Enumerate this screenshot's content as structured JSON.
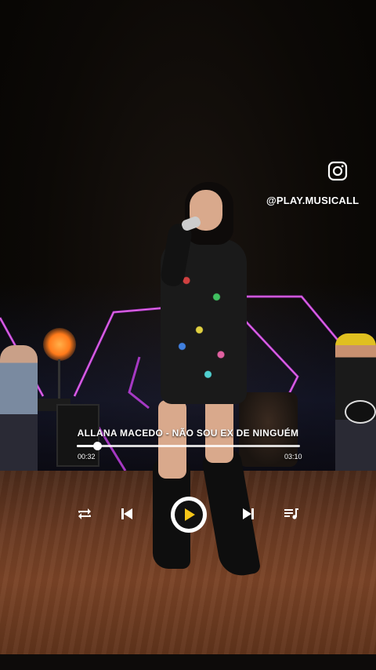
{
  "overlay": {
    "social_handle": "@PLAY.MUSICALL",
    "social_icon": "instagram-icon"
  },
  "player": {
    "track_title": "ALLANA MACEDO - NÃO SOU EX DE NINGUÉM",
    "elapsed": "00:32",
    "duration": "03:10",
    "progress_fraction": 0.09,
    "accent_color": "#f5c518",
    "controls": {
      "repeat_icon": "repeat-icon",
      "previous_icon": "skip-previous-icon",
      "play_icon": "play-icon",
      "next_icon": "skip-next-icon",
      "queue_icon": "queue-music-icon"
    }
  }
}
